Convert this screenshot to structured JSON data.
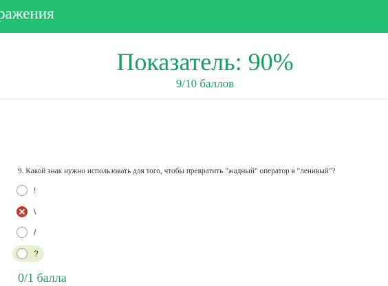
{
  "header": {
    "title": "ражения"
  },
  "score": {
    "title": "Показатель: 90%",
    "subtitle": "9/10 баллов"
  },
  "question": {
    "text": "9. Какой знак нужно использовать для того, чтобы превратить \"жадный\" оператор в \"ленивый\"?",
    "options": [
      {
        "label": "!",
        "state": "unselected"
      },
      {
        "label": "\\",
        "state": "selected-wrong"
      },
      {
        "label": "/",
        "state": "unselected"
      },
      {
        "label": "?",
        "state": "correct-highlight"
      }
    ],
    "points": "0/1 балла"
  },
  "colors": {
    "brand": "#22c073",
    "score_text": "#1e9d63",
    "wrong": "#c0392b",
    "correct_highlight": "#e7f0cf"
  }
}
